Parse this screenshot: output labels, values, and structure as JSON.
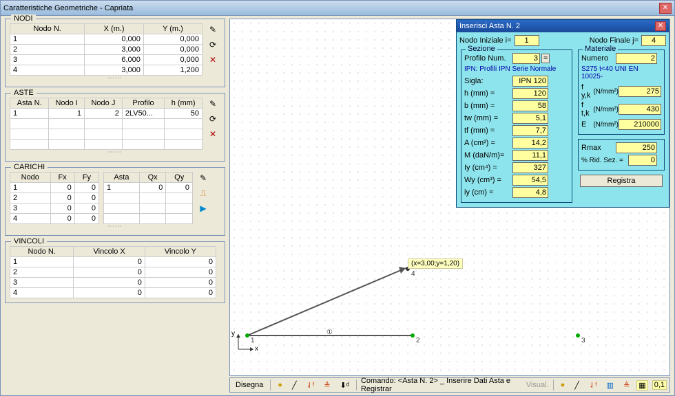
{
  "window_title": "Caratteristiche Geometriche - Capriata",
  "groups": {
    "nodi": {
      "title": "NODI",
      "headers": [
        "Nodo N.",
        "X (m.)",
        "Y (m.)"
      ],
      "rows": [
        [
          "1",
          "0,000",
          "0,000"
        ],
        [
          "2",
          "3,000",
          "0,000"
        ],
        [
          "3",
          "6,000",
          "0,000"
        ],
        [
          "4",
          "3,000",
          "1,200"
        ]
      ]
    },
    "aste": {
      "title": "ASTE",
      "headers": [
        "Asta N.",
        "Nodo I",
        "Nodo J",
        "Profilo",
        "h (mm)"
      ],
      "rows": [
        [
          "1",
          "1",
          "2",
          "2LV50...",
          "50"
        ]
      ]
    },
    "carichi": {
      "title": "CARICHI",
      "t1_headers": [
        "Nodo",
        "Fx",
        "Fy"
      ],
      "t1_rows": [
        [
          "1",
          "0",
          "0"
        ],
        [
          "2",
          "0",
          "0"
        ],
        [
          "3",
          "0",
          "0"
        ],
        [
          "4",
          "0",
          "0"
        ]
      ],
      "t2_headers": [
        "Asta",
        "Qx",
        "Qy"
      ],
      "t2_rows": [
        [
          "1",
          "0",
          "0"
        ]
      ]
    },
    "vincoli": {
      "title": "VINCOLI",
      "headers": [
        "Nodo N.",
        "Vincolo X",
        "Vincolo Y"
      ],
      "rows": [
        [
          "1",
          "0",
          "0"
        ],
        [
          "2",
          "0",
          "0"
        ],
        [
          "3",
          "0",
          "0"
        ],
        [
          "4",
          "0",
          "0"
        ]
      ]
    }
  },
  "panel": {
    "title": "Inserisci Asta N. 2",
    "nodo_iniziale_lbl": "Nodo Iniziale  i=",
    "nodo_iniziale_val": "1",
    "nodo_finale_lbl": "Nodo Finale j=",
    "nodo_finale_val": "4",
    "sezione": {
      "title": "Sezione",
      "profilo_lbl": "Profilo Num.",
      "profilo_val": "3",
      "ipn_note": "IPN: Profili IPN Serie Normale",
      "rows": [
        [
          "Sigla:",
          "IPN 120"
        ],
        [
          "h (mm) =",
          "120"
        ],
        [
          "b (mm) =",
          "58"
        ],
        [
          "tw (mm) =",
          "5,1"
        ],
        [
          "tf (mm) =",
          "7,7"
        ],
        [
          "A (cm²) =",
          "14,2"
        ],
        [
          "M (daN/m)=",
          "11,1"
        ],
        [
          "Iy  (cm⁴) =",
          "327"
        ],
        [
          "Wy (cm³) =",
          "54,5"
        ],
        [
          "iy  (cm) =",
          "4,8"
        ]
      ]
    },
    "materiale": {
      "title": "Materiale",
      "numero_lbl": "Numero",
      "numero_val": "2",
      "note": "S275 t<40 UNI EN 10025-",
      "rows": [
        [
          "f y,k",
          "(N/mm²)",
          "275"
        ],
        [
          "f t,k",
          "(N/mm²)",
          "430"
        ],
        [
          "E",
          "(N/mm²)",
          "210000"
        ]
      ]
    },
    "rmax_lbl": "Rmax",
    "rmax_val": "250",
    "rid_lbl": "% Rid. Sez. =",
    "rid_val": "0",
    "registra": "Registra"
  },
  "canvas": {
    "tooltip": "(x=3,00;y=1,20)",
    "node_labels": [
      "1",
      "2",
      "3",
      "4"
    ],
    "axis_x": "x",
    "axis_y": "y",
    "midlabel": "①"
  },
  "statusbar": {
    "disegna": "Disegna",
    "comando": "Comando: <Asta N. 2> _ Inserire Dati Asta e Registrar",
    "visual": "Visual.",
    "zoom": "0,1"
  }
}
